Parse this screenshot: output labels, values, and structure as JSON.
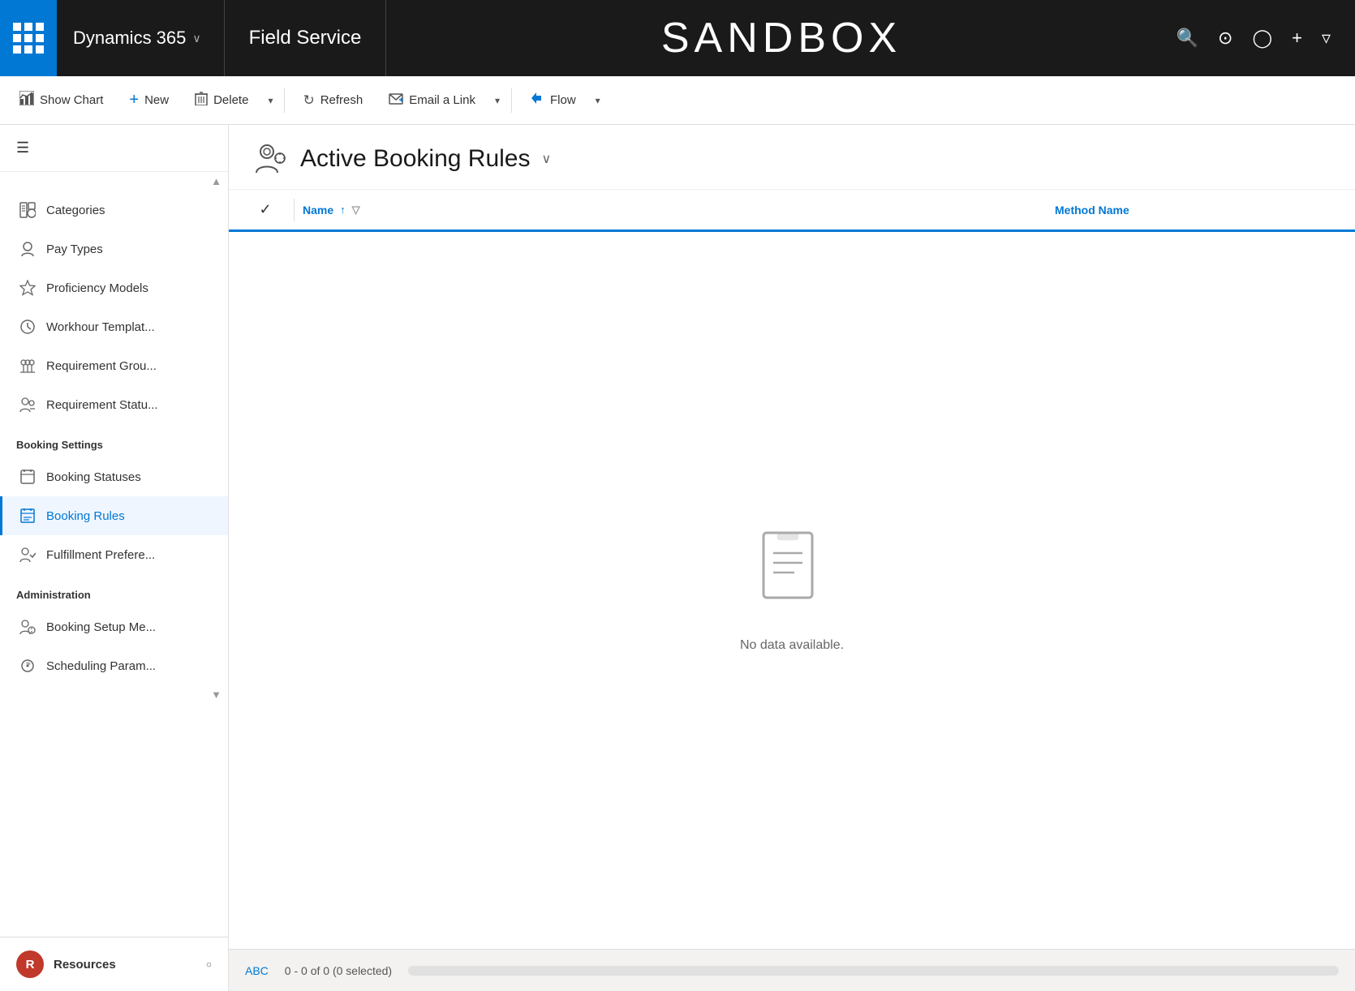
{
  "topnav": {
    "app_name": "Dynamics 365",
    "module_name": "Field Service",
    "sandbox_label": "SANDBOX",
    "chevron": "∨"
  },
  "toolbar": {
    "show_chart": "Show Chart",
    "new": "New",
    "delete": "Delete",
    "refresh": "Refresh",
    "email_link": "Email a Link",
    "flow": "Flow"
  },
  "sidebar": {
    "hamburger_icon": "☰",
    "items": [
      {
        "id": "categories",
        "label": "Categories",
        "icon": "person-card"
      },
      {
        "id": "pay-types",
        "label": "Pay Types",
        "icon": "person-card"
      },
      {
        "id": "proficiency-models",
        "label": "Proficiency Models",
        "icon": "star"
      },
      {
        "id": "workhour-templates",
        "label": "Workhour Templat...",
        "icon": "clock"
      },
      {
        "id": "requirement-groups",
        "label": "Requirement Grou...",
        "icon": "people-list"
      },
      {
        "id": "requirement-statuses",
        "label": "Requirement Statu...",
        "icon": "people-settings"
      }
    ],
    "booking_settings_header": "Booking Settings",
    "booking_items": [
      {
        "id": "booking-statuses",
        "label": "Booking Statuses",
        "icon": "flag"
      },
      {
        "id": "booking-rules",
        "label": "Booking Rules",
        "icon": "calendar",
        "active": true
      },
      {
        "id": "fulfillment-preferences",
        "label": "Fulfillment Prefere...",
        "icon": "people-settings"
      }
    ],
    "administration_header": "Administration",
    "admin_items": [
      {
        "id": "booking-setup",
        "label": "Booking Setup Me...",
        "icon": "people-settings"
      },
      {
        "id": "scheduling-params",
        "label": "Scheduling Param...",
        "icon": "gear"
      }
    ],
    "bottom": {
      "avatar_letter": "R",
      "label": "Resources",
      "chevron": "○"
    }
  },
  "content": {
    "title": "Active Booking Rules",
    "header_chevron": "∨",
    "table": {
      "col_name": "Name",
      "col_method": "Method Name",
      "sort_icon": "↑",
      "empty_message": "No data available."
    },
    "footer": {
      "abc_label": "ABC",
      "count_label": "0 - 0 of 0 (0 selected)"
    }
  }
}
